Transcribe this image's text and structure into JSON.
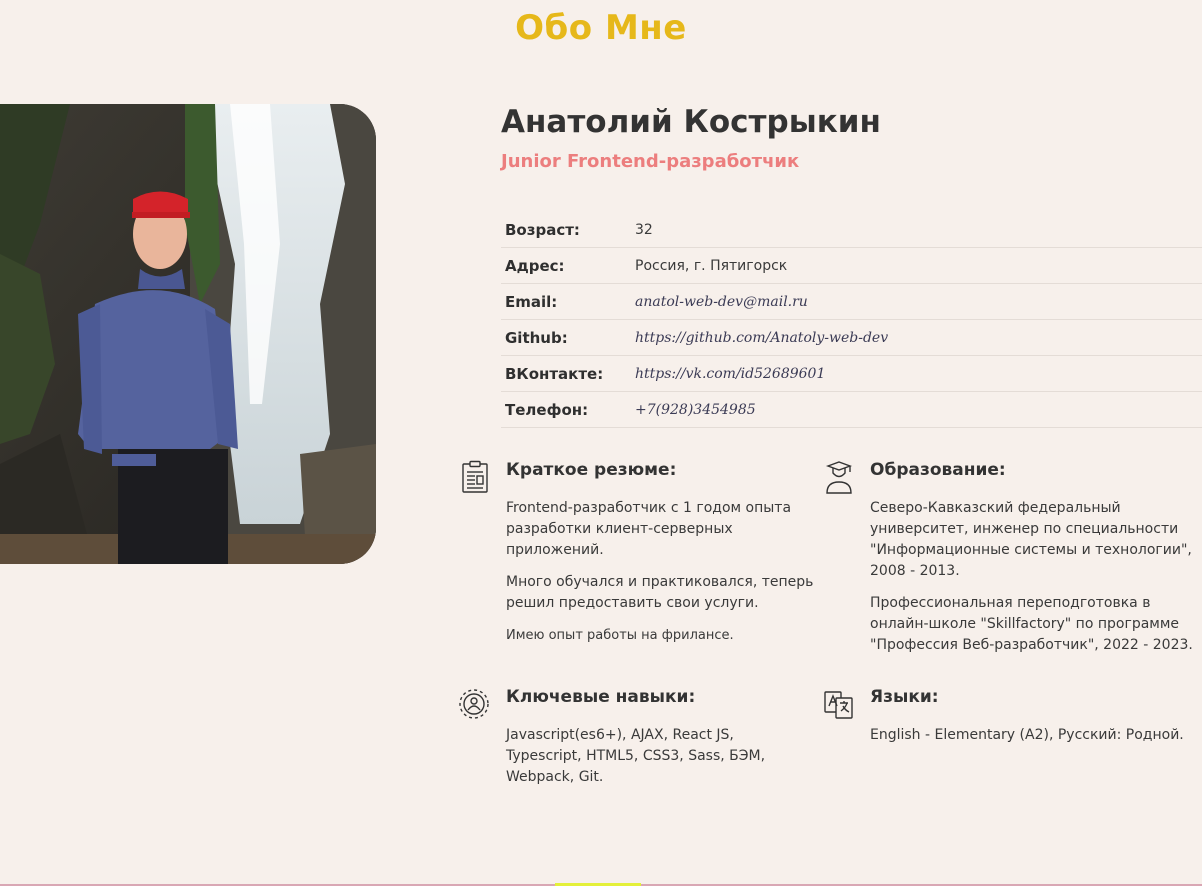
{
  "page": {
    "title": "Обо Мне"
  },
  "profile": {
    "name": "Анатолий Кострыкин",
    "role": "Junior Frontend-разработчик",
    "photo_icon": "profile-photo"
  },
  "info": [
    {
      "label": "Возраст:",
      "value": "32",
      "link": false
    },
    {
      "label": "Адрес:",
      "value": "Россия, г. Пятигорск",
      "link": false
    },
    {
      "label": "Email:",
      "value": "anatol-web-dev@mail.ru",
      "link": true
    },
    {
      "label": "Github:",
      "value": "https://github.com/Anatoly-web-dev",
      "link": true
    },
    {
      "label": "ВКонтакте:",
      "value": "https://vk.com/id52689601",
      "link": true
    },
    {
      "label": "Телефон:",
      "value": "+7(928)3454985",
      "link": true
    }
  ],
  "sections": {
    "summary": {
      "icon": "resume-document-icon",
      "title": "Краткое резюме:",
      "paragraphs": [
        "Frontend-разработчик с 1 годом опыта разработки клиент-серверных приложений.",
        "Много обучался и практиковался, теперь решил предоставить свои услуги.",
        "Имею опыт работы на фрилансе."
      ]
    },
    "education": {
      "icon": "graduate-icon",
      "title": "Образование:",
      "paragraphs": [
        "Северо-Кавказский федеральный университет, инженер по специальности \"Информационные системы и технологии\", 2008 - 2013.",
        "Профессиональная переподготовка в онлайн-школе \"Skillfactory\" по программе \"Профессия Веб-разработчик\", 2022 - 2023."
      ]
    },
    "skills": {
      "icon": "gear-user-icon",
      "title": "Ключевые навыки:",
      "paragraphs": [
        "Javascript(es6+), AJAX, React JS, Typescript, HTML5, CSS3, Sass, БЭМ, Webpack, Git."
      ]
    },
    "languages": {
      "icon": "translate-icon",
      "title": "Языки:",
      "paragraphs": [
        "English - Elementary (A2), Русский: Родной."
      ]
    }
  },
  "colors": {
    "background": "#f7f0eb",
    "title_accent": "#e6b81a",
    "role_accent": "#ec7e7e",
    "text": "#3a3a3a"
  }
}
